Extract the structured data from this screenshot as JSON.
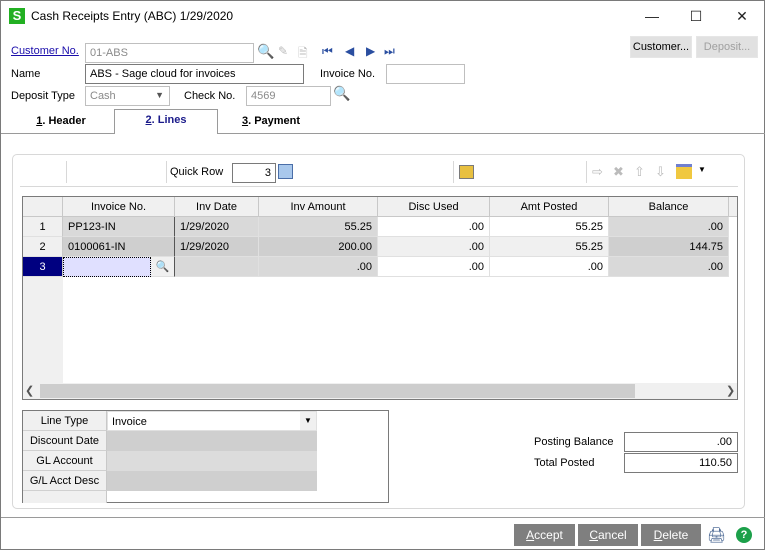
{
  "window": {
    "title": "Cash Receipts Entry (ABC) 1/29/2020",
    "app_logo": "S",
    "controls": {
      "minimize": "—",
      "maximize": "☐",
      "close": "✕"
    }
  },
  "header": {
    "customer_no_label": "Customer No.",
    "customer_no_value": "01-ABS",
    "name_label": "Name",
    "name_value": "ABS - Sage cloud for invoices",
    "invoice_no_label": "Invoice No.",
    "invoice_no_value": "",
    "deposit_type_label": "Deposit Type",
    "deposit_type_value": "Cash",
    "check_no_label": "Check No.",
    "check_no_value": "4569",
    "customer_button": "Customer...",
    "deposit_button": "Deposit..."
  },
  "tabs": [
    {
      "key": "1",
      "label": ". Header",
      "active": false
    },
    {
      "key": "2",
      "label": ". Lines",
      "active": true
    },
    {
      "key": "3",
      "label": ". Payment",
      "active": false
    }
  ],
  "toolbar": {
    "quick_row_label": "Quick Row",
    "quick_row_value": "3"
  },
  "grid": {
    "columns": [
      "",
      "Invoice No.",
      "Inv Date",
      "Inv Amount",
      "Disc Used",
      "Amt Posted",
      "Balance"
    ],
    "rows": [
      {
        "num": "1",
        "invoice_no": "PP123-IN",
        "inv_date": "1/29/2020",
        "inv_amount": "55.25",
        "disc_used": ".00",
        "amt_posted": "55.25",
        "balance": ".00"
      },
      {
        "num": "2",
        "invoice_no": "0100061-IN",
        "inv_date": "1/29/2020",
        "inv_amount": "200.00",
        "disc_used": ".00",
        "amt_posted": "55.25",
        "balance": "144.75"
      },
      {
        "num": "3",
        "invoice_no": "",
        "inv_date": "",
        "inv_amount": ".00",
        "disc_used": ".00",
        "amt_posted": ".00",
        "balance": ".00"
      }
    ]
  },
  "detail": {
    "line_type_label": "Line Type",
    "line_type_value": "Invoice",
    "discount_date_label": "Discount Date",
    "gl_account_label": "GL Account",
    "gl_acct_desc_label": "G/L Acct Desc"
  },
  "totals": {
    "posting_balance_label": "Posting Balance",
    "posting_balance_value": ".00",
    "total_posted_label": "Total Posted",
    "total_posted_value": "110.50"
  },
  "actions": {
    "accept": {
      "key": "A",
      "rest": "ccept"
    },
    "cancel": {
      "key": "C",
      "rest": "ancel"
    },
    "delete": {
      "key": "D",
      "rest": "elete"
    }
  }
}
